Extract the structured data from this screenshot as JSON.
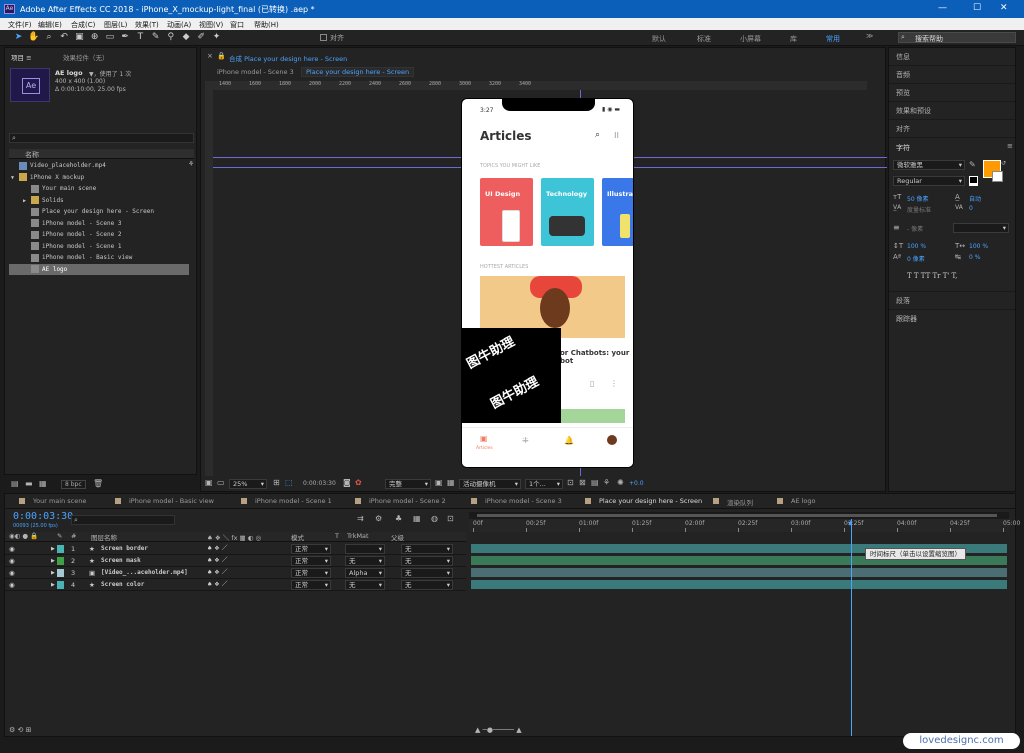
{
  "title": "Adobe After Effects CC 2018 - iPhone_X_mockup-light_final (已转换) .aep *",
  "window_controls": [
    "—",
    "☐",
    "✕"
  ],
  "menu": [
    "文件(F)",
    "编辑(E)",
    "合成(C)",
    "图层(L)",
    "效果(T)",
    "动画(A)",
    "视图(V)",
    "窗口",
    "帮助(H)"
  ],
  "toolbar": {
    "align": "对齐",
    "workspaces": [
      "默认",
      "标准",
      "小屏幕",
      "库",
      "常用"
    ],
    "search_placeholder": "搜索帮助"
  },
  "project": {
    "tab": "项目 ≡",
    "effects_tab": "效果控件（无）",
    "item_name": "AE logo",
    "usage": "▼，使用了 1 次",
    "size": "400 x 400 (1.00)",
    "duration": "Δ 0:00:10:00, 25.00 fps",
    "name_header": "名称",
    "bpc": "8 bpc",
    "items": [
      {
        "name": "Video_placeholder.mp4",
        "indent": 0,
        "icon": "#6a8cb8",
        "arrow": ""
      },
      {
        "name": "iPhone X mockup",
        "indent": 0,
        "icon": "#c9a74d",
        "arrow": "▼"
      },
      {
        "name": "Your main scene",
        "indent": 1,
        "icon": "#8a8a8a",
        "arrow": ""
      },
      {
        "name": "Solids",
        "indent": 1,
        "icon": "#c9a74d",
        "arrow": "▶"
      },
      {
        "name": "Place your design here - Screen",
        "indent": 1,
        "icon": "#8a8a8a",
        "arrow": ""
      },
      {
        "name": "iPhone model - Scene 3",
        "indent": 1,
        "icon": "#8a8a8a",
        "arrow": ""
      },
      {
        "name": "iPhone model - Scene 2",
        "indent": 1,
        "icon": "#8a8a8a",
        "arrow": ""
      },
      {
        "name": "iPhone model - Scene 1",
        "indent": 1,
        "icon": "#8a8a8a",
        "arrow": ""
      },
      {
        "name": "iPhone model - Basic view",
        "indent": 1,
        "icon": "#8a8a8a",
        "arrow": ""
      },
      {
        "name": "AE logo",
        "indent": 1,
        "icon": "#8a8a8a",
        "arrow": "",
        "selected": true
      }
    ]
  },
  "comp": {
    "tab_title": "合成 Place your design here - Screen",
    "breadcrumb": [
      "iPhone model - Scene 3",
      "Place your design here - Screen"
    ],
    "ruler_marks": [
      "1400",
      "1600",
      "1800",
      "2000",
      "2200",
      "2400",
      "2600",
      "2800",
      "3000",
      "3200",
      "3400"
    ],
    "zoom": "25%",
    "timecode": "0:00:03:30",
    "resolution": "完整",
    "camera": "活动摄像机",
    "views": "1个...",
    "exposure": "+0.0"
  },
  "phone": {
    "time": "3:27",
    "heading": "Articles",
    "section1": "TOPICS YOU MIGHT LIKE",
    "cards": [
      {
        "label": "UI Design",
        "color": "#ef5e5e"
      },
      {
        "label": "Technology",
        "color": "#3dc4d6"
      },
      {
        "label": "Illustrat",
        "color": "#3a77e8"
      }
    ],
    "section2": "HOTTEST ARTICLES",
    "article_title": "or Chatbots: your bot",
    "nav_label": "Articles",
    "watermark": "图牛助理"
  },
  "right_panel": {
    "items": [
      "信息",
      "音频",
      "预览",
      "效果和预设",
      "对齐"
    ],
    "char_title": "字符",
    "font": "微软雅黑",
    "style": "Regular",
    "size": "50 像素",
    "leading": "自动",
    "kerning": "度量标准",
    "tracking": "0",
    "stroke": "- 像素",
    "vscale": "100 %",
    "hscale": "100 %",
    "baseline": "0 像素",
    "tsume": "0 %",
    "styles_row": "T  T  TT  Tr  T'  T,",
    "paragraph": "段落",
    "tracker": "跟踪器",
    "fill_color": "#ff9a00"
  },
  "timeline": {
    "tabs": [
      "Your main scene",
      "iPhone model - Basic view",
      "iPhone model - Scene 1",
      "iPhone model - Scene 2",
      "iPhone model - Scene 3",
      "Place your design here - Screen",
      "渲染队列",
      "AE logo"
    ],
    "timecode": "0:00:03:30",
    "fps": "00093 (25.00 fps)",
    "columns": {
      "num": "#",
      "name": "图层名称",
      "mode": "模式",
      "t": "T",
      "trkmat": "TrkMat",
      "parent": "父级"
    },
    "ruler": [
      "00f",
      "00:25f",
      "01:00f",
      "01:25f",
      "02:00f",
      "02:25f",
      "03:00f",
      "03:25f",
      "04:00f",
      "04:25f",
      "05:00"
    ],
    "tooltip": "时间标尺（单击以设置缩览图）",
    "layers": [
      {
        "num": "1",
        "name": "Screen border",
        "type": "★",
        "mode": "正常",
        "trk": "",
        "parent": "无",
        "color": "#4ab4b4",
        "bar": "#3a7a7a"
      },
      {
        "num": "2",
        "name": "Screen mask",
        "type": "★",
        "mode": "正常",
        "trk": "无",
        "parent": "无",
        "color": "#3fa046",
        "bar": "#3a7a58"
      },
      {
        "num": "3",
        "name": "[Video_...aceholder.mp4]",
        "type": "▣",
        "mode": "正常",
        "trk": "Alpha",
        "parent": "无",
        "color": "#a4c8d4",
        "bar": "#4a6e74"
      },
      {
        "num": "4",
        "name": "Screen color",
        "type": "★",
        "mode": "正常",
        "trk": "无",
        "parent": "无",
        "color": "#4ab4b4",
        "bar": "#3a7a7a"
      }
    ]
  },
  "footer_watermark": "lovedesignc.com"
}
